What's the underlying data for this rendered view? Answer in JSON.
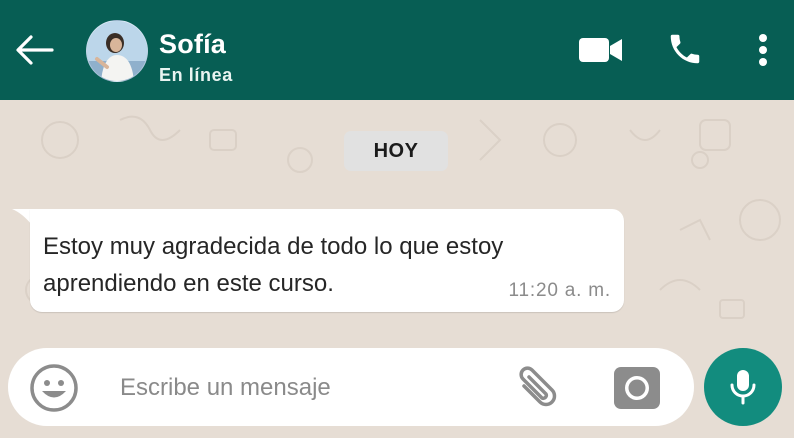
{
  "header": {
    "back_icon": "arrow-left-icon",
    "contact_name": "Sofía",
    "contact_status": "En línea",
    "video_icon": "video-camera-icon",
    "call_icon": "phone-icon",
    "menu_icon": "more-vertical-icon"
  },
  "chat": {
    "date_label": "HOY",
    "messages": [
      {
        "text": "Estoy muy agradecida de todo lo que estoy aprendiendo en este curso.",
        "time": "11:20 a. m.",
        "direction": "incoming"
      }
    ]
  },
  "composer": {
    "placeholder": "Escribe un mensaje",
    "value": "",
    "emoji_icon": "emoji-icon",
    "attach_icon": "paperclip-icon",
    "camera_icon": "camera-icon",
    "mic_icon": "microphone-icon"
  },
  "colors": {
    "header": "#075e54",
    "mic_button": "#128c7e",
    "wallpaper": "#e6ddd4",
    "bubble": "#ffffff"
  }
}
